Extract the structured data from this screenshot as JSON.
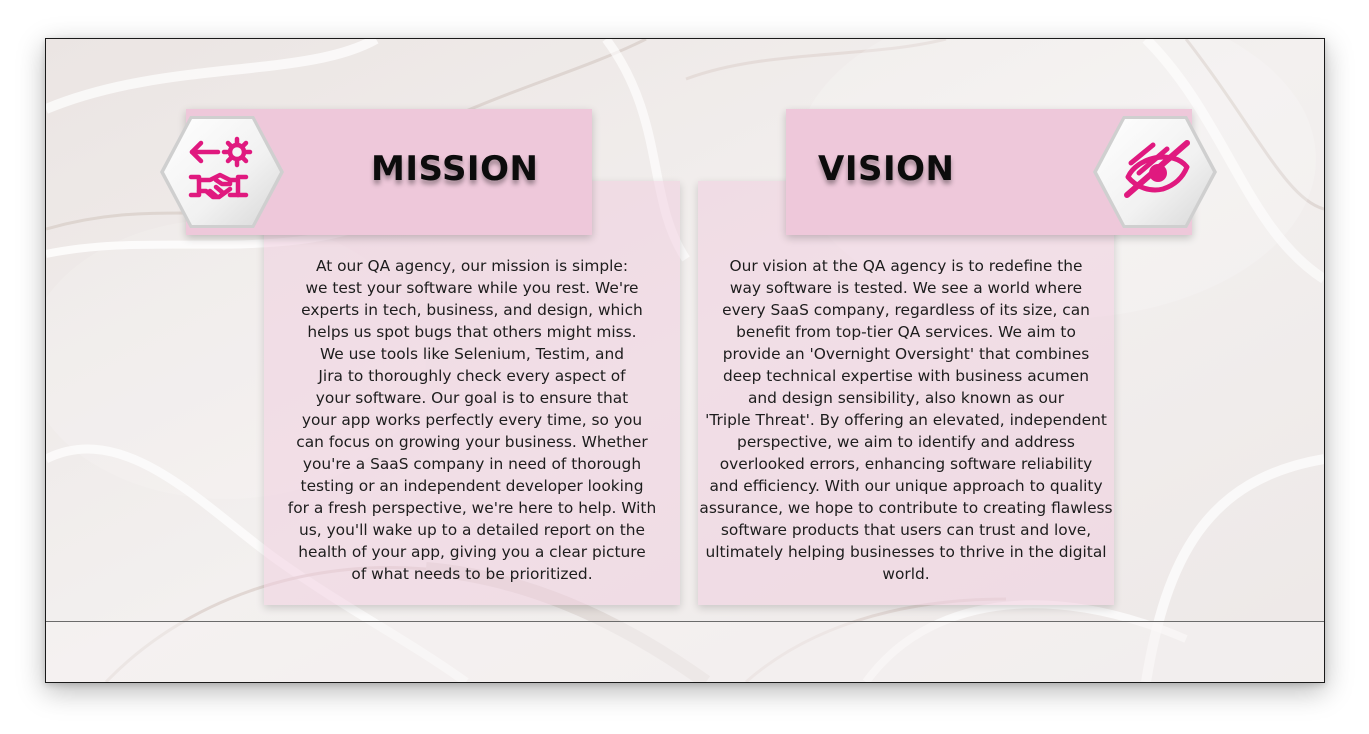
{
  "colors": {
    "accent": "#e0197f",
    "banner": "#eec8da",
    "card": "#f0cdde",
    "title": "#0c0c0c",
    "body_text": "#1d1d1d"
  },
  "mission": {
    "title": "MISSION",
    "icon": "handshake-gear-icon",
    "lines": [
      "At our QA agency, our mission is simple:",
      "we test your software while you rest. We're",
      "experts in tech, business, and design, which",
      "helps us spot bugs that others might miss.",
      "We use tools like Selenium, Testim, and",
      "Jira to thoroughly check every aspect of",
      "your software. Our goal is to ensure that",
      "your app works perfectly every time, so you",
      "can focus on growing your business. Whether",
      "you're a SaaS company in need of thorough",
      "testing or an independent developer looking",
      "for a fresh perspective, we're here to help. With",
      "us, you'll wake up to a detailed report on the",
      "health of your app, giving you a clear picture",
      "of what needs to be prioritized."
    ]
  },
  "vision": {
    "title": "VISION",
    "icon": "eye-slash-icon",
    "lines": [
      "Our vision at the QA agency is to redefine the",
      "way software is tested. We see a world where",
      "every SaaS company, regardless of its size, can",
      "benefit from top-tier QA services. We aim to",
      "provide an 'Overnight Oversight' that combines",
      "deep technical expertise with business acumen",
      "and design sensibility, also known as our",
      "'Triple Threat'. By offering an elevated, independent",
      "perspective, we aim to identify and address",
      "overlooked errors, enhancing software reliability",
      "and efficiency. With our unique approach to quality",
      "assurance, we hope to contribute to creating flawless",
      "software products that users can trust and love,",
      "ultimately helping businesses to thrive in the digital",
      "world."
    ]
  }
}
